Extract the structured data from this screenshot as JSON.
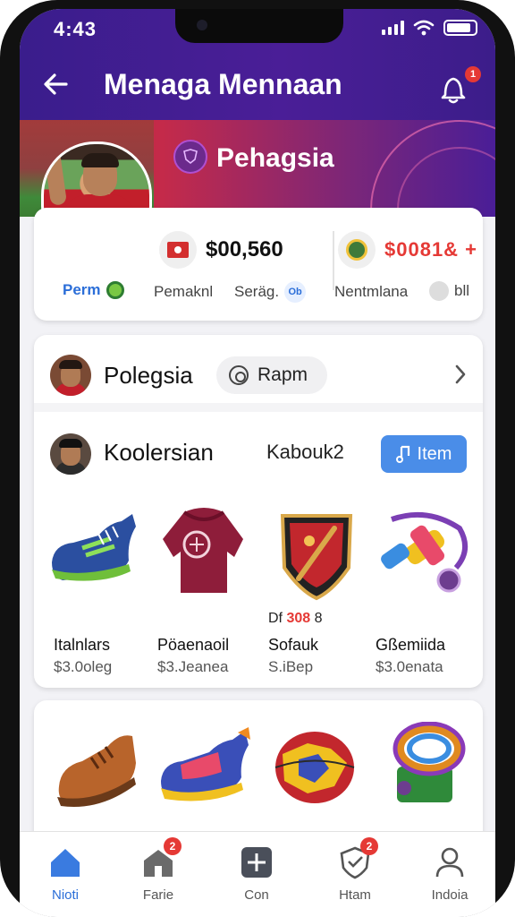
{
  "status_bar": {
    "time": "4:43"
  },
  "header": {
    "title": "Menaga Mennaan",
    "notification_count": "1"
  },
  "hero": {
    "title": "Pehagsia"
  },
  "stats": {
    "balance_value": "$00,560",
    "points_value": "$0081& +",
    "label_perm": "Perm",
    "label_pemaknl": "Pemaknl",
    "label_serag": "Seräg.",
    "label_serag_badge": "Ob",
    "label_nentmlana": "Nentmlana",
    "label_nentmlana_suffix": "bll"
  },
  "profile_row": {
    "name": "Polegsia",
    "button_label": "Rapm"
  },
  "collection": {
    "title": "Koolersian",
    "subtitle": "Kabouk2",
    "item_button_label": "Item",
    "tag_prefix": "Df",
    "tag_value": "308",
    "tag_suffix": "8",
    "items": [
      {
        "name": "Italnlars",
        "price": "$3.0oleg",
        "icon": "sneaker-icon"
      },
      {
        "name": "Pöaenaoil",
        "price": "$3.Jeanea",
        "icon": "jersey-icon"
      },
      {
        "name": "Sofauk",
        "price": "S.iBep",
        "icon": "shield-badge-icon"
      },
      {
        "name": "Gßemiida",
        "price": "$3.0enata",
        "icon": "accessory-icon"
      }
    ],
    "more_items": [
      {
        "icon": "boot-icon"
      },
      {
        "icon": "colorful-sneaker-icon"
      },
      {
        "icon": "ball-icon"
      },
      {
        "icon": "wristband-icon"
      }
    ]
  },
  "tabbar": {
    "tabs": [
      {
        "label": "Nioti",
        "icon": "home-icon",
        "badge": ""
      },
      {
        "label": "Farie",
        "icon": "store-icon",
        "badge": "2"
      },
      {
        "label": "Con",
        "icon": "plus-box-icon",
        "badge": ""
      },
      {
        "label": "Htam",
        "icon": "shield-heart-icon",
        "badge": "2"
      },
      {
        "label": "Indoia",
        "icon": "profile-icon",
        "badge": ""
      }
    ]
  },
  "colors": {
    "header": "#3a1d8c",
    "accent": "#4a8de8",
    "badge": "#e53935",
    "jersey_red": "#c21f2b"
  }
}
